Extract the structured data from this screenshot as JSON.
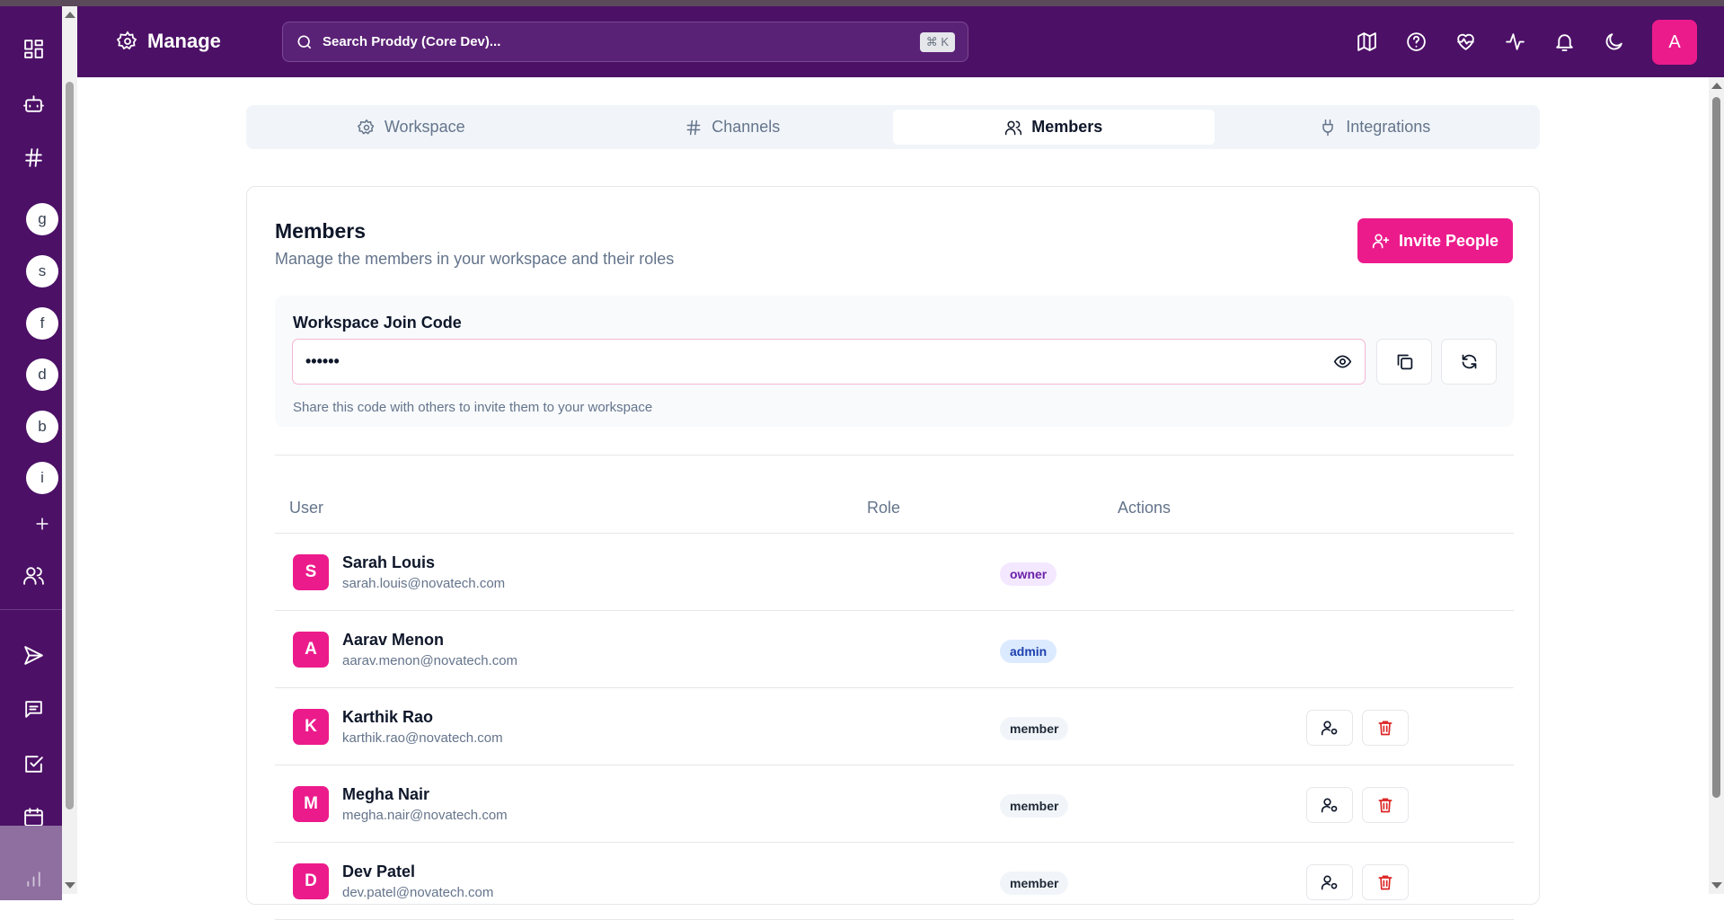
{
  "header": {
    "title": "Manage",
    "search_placeholder": "Search Proddy (Core Dev)...",
    "search_shortcut": "⌘ K",
    "avatar_letter": "A"
  },
  "rail": {
    "workspace_letters": [
      "g",
      "s",
      "f",
      "d",
      "b",
      "i"
    ]
  },
  "tabs": [
    {
      "label": "Workspace",
      "icon": "gear-icon"
    },
    {
      "label": "Channels",
      "icon": "hash-icon"
    },
    {
      "label": "Members",
      "icon": "users-icon",
      "active": true
    },
    {
      "label": "Integrations",
      "icon": "plug-icon"
    }
  ],
  "members": {
    "title": "Members",
    "subtitle": "Manage the members in your workspace and their roles",
    "invite_label": "Invite People",
    "join_code_label": "Workspace Join Code",
    "join_code_value": "••••••",
    "join_code_hint": "Share this code with others to invite them to your workspace",
    "columns": {
      "user": "User",
      "role": "Role",
      "actions": "Actions"
    },
    "rows": [
      {
        "initial": "S",
        "name": "Sarah Louis",
        "email": "sarah.louis@novatech.com",
        "role": "owner"
      },
      {
        "initial": "A",
        "name": "Aarav Menon",
        "email": "aarav.menon@novatech.com",
        "role": "admin"
      },
      {
        "initial": "K",
        "name": "Karthik Rao",
        "email": "karthik.rao@novatech.com",
        "role": "member"
      },
      {
        "initial": "M",
        "name": "Megha Nair",
        "email": "megha.nair@novatech.com",
        "role": "member"
      },
      {
        "initial": "D",
        "name": "Dev Patel",
        "email": "dev.patel@novatech.com",
        "role": "member"
      }
    ]
  },
  "colors": {
    "brand": "#4c1066",
    "accent": "#ec1b8c",
    "danger": "#dc2626"
  }
}
